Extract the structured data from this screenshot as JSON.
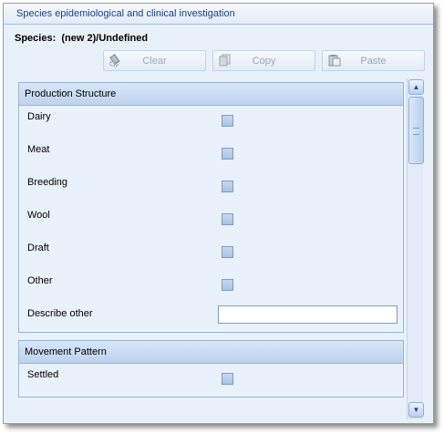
{
  "window": {
    "title": "Species epidemiological and clinical investigation"
  },
  "species": {
    "label": "Species:",
    "value": "(new 2)/Undefined"
  },
  "toolbar": {
    "clear_label": "Clear",
    "copy_label": "Copy",
    "paste_label": "Paste"
  },
  "groups": {
    "production": {
      "title": "Production Structure",
      "items": [
        {
          "label": "Dairy",
          "checked": false
        },
        {
          "label": "Meat",
          "checked": false
        },
        {
          "label": "Breeding",
          "checked": false
        },
        {
          "label": "Wool",
          "checked": false
        },
        {
          "label": "Draft",
          "checked": false
        },
        {
          "label": "Other",
          "checked": false
        }
      ],
      "describe_other_label": "Describe other",
      "describe_other_value": ""
    },
    "movement": {
      "title": "Movement Pattern",
      "items": [
        {
          "label": "Settled",
          "checked": false
        }
      ]
    }
  },
  "icons": {
    "clear": "eraser-icon",
    "copy": "copy-icon",
    "paste": "paste-icon",
    "scroll_up": "chevron-up-icon",
    "scroll_down": "chevron-down-icon"
  }
}
